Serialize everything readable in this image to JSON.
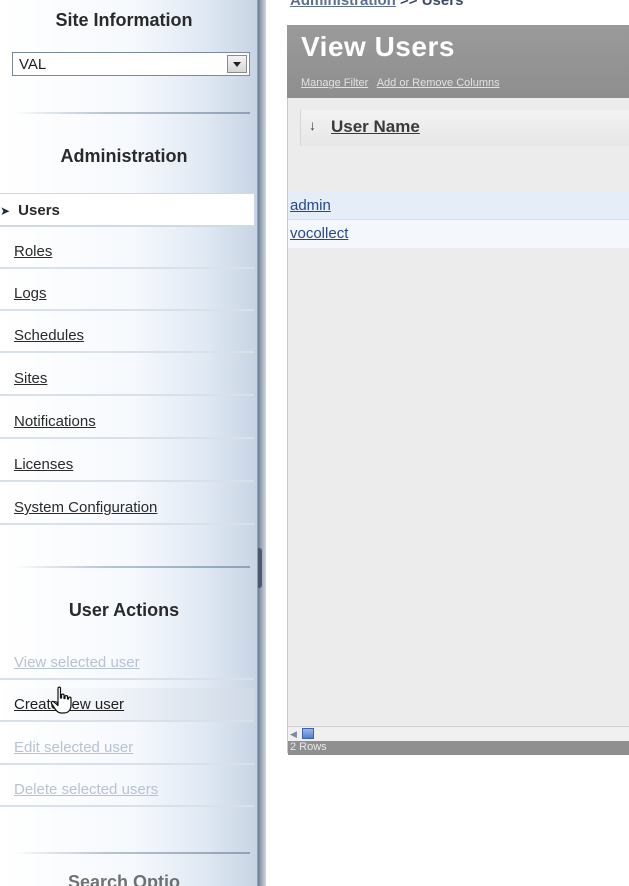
{
  "sidebar": {
    "site_info_title": "Site Information",
    "site_select_value": "VAL",
    "administration_title": "Administration",
    "nav": [
      {
        "label": "Users",
        "active": true
      },
      {
        "label": "Roles"
      },
      {
        "label": "Logs"
      },
      {
        "label": "Schedules"
      },
      {
        "label": "Sites"
      },
      {
        "label": "Notifications"
      },
      {
        "label": "Licenses"
      },
      {
        "label": "System Configuration"
      }
    ],
    "user_actions_title": "User Actions",
    "actions": [
      {
        "label": "View selected user",
        "enabled": false
      },
      {
        "label": "Create new user",
        "enabled": true
      },
      {
        "label": "Edit selected user",
        "enabled": false
      },
      {
        "label": "Delete selected users",
        "enabled": false
      }
    ],
    "bottom_section_title": "Search Optio"
  },
  "main": {
    "breadcrumb": {
      "root": "Administration",
      "separator": ">>",
      "current": "Users"
    },
    "panel_title": "View Users",
    "header_links": [
      "Manage Filter",
      "Add or Remove Columns"
    ],
    "table": {
      "column": "User Name",
      "rows": [
        "admin",
        "vocollect"
      ],
      "footer": "2 Rows"
    }
  },
  "icons": {
    "active_arrow": "arrow-right-icon",
    "sort": "sort-down-icon",
    "cursor": "hand-pointer-icon",
    "dropdown": "chevron-down-icon"
  },
  "colors": {
    "panel_header": "#8e8e8e",
    "link": "#23498f",
    "disabled_action": "#b7c2d2"
  }
}
